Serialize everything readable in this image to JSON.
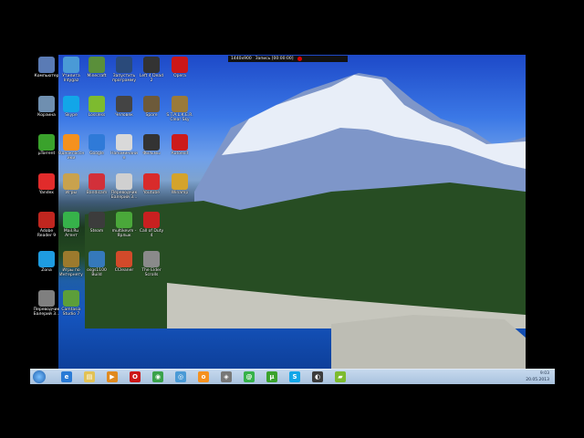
{
  "recording_bar": {
    "app": "1440x900",
    "status": "Запись [00:00:00]"
  },
  "desktop_icons": [
    {
      "label": "Компьютер",
      "icon": "computer-icon",
      "color": "#5a7bb5"
    },
    {
      "label": "Корзина",
      "icon": "recycle-bin-icon",
      "color": "#6f8fb0"
    },
    {
      "label": "μTorrent",
      "icon": "utorrent-icon",
      "color": "#3aa22c"
    },
    {
      "label": "Yandex",
      "icon": "yandex-icon",
      "color": "#e12b2b"
    },
    {
      "label": "Adobe Reader 9",
      "icon": "adobe-reader-icon",
      "color": "#c0261f"
    },
    {
      "label": "Zona",
      "icon": "zona-icon",
      "color": "#1e9ce0"
    },
    {
      "label": "Переводчик Балерий 3...",
      "icon": "translator-icon",
      "color": "#7f7f7f"
    },
    {
      "label": "Утилита Intygaz",
      "icon": "search-icon",
      "color": "#4a9ad6"
    },
    {
      "label": "Skype",
      "icon": "skype-icon",
      "color": "#12a6e8"
    },
    {
      "label": "Одноклассники",
      "icon": "odnoklassniki-icon",
      "color": "#f5911e"
    },
    {
      "label": "Игры",
      "icon": "games-icon",
      "color": "#c9a24d"
    },
    {
      "label": "Mail.Ru Агент",
      "icon": "mail-agent-icon",
      "color": "#36b24a"
    },
    {
      "label": "Игры по Интернету",
      "icon": "internet-games-icon",
      "color": "#9c7a2d"
    },
    {
      "label": "Camtasia Studio 7",
      "icon": "camtasia-icon",
      "color": "#5c9e3a"
    },
    {
      "label": "Minecraft",
      "icon": "minecraft-icon",
      "color": "#5a8f3a"
    },
    {
      "label": "Lossless",
      "icon": "lossless-icon",
      "color": "#7dbb2f"
    },
    {
      "label": "Google",
      "icon": "google-icon",
      "color": "#2f7ad8"
    },
    {
      "label": "Bandicam",
      "icon": "bandicam-icon",
      "color": "#d2303a"
    },
    {
      "label": "Steam",
      "icon": "steam-icon",
      "color": "#3c3c3c"
    },
    {
      "label": "osgs1100 Build",
      "icon": "globe-icon",
      "color": "#3579bb"
    },
    {
      "label": "Запустить программу",
      "icon": "run-program-icon",
      "color": "#2a4a7a"
    },
    {
      "label": "Человек",
      "icon": "person-icon",
      "color": "#444"
    },
    {
      "label": "Напоминание",
      "icon": "document-icon",
      "color": "#d9d9d9"
    },
    {
      "label": "Переводчик Балерий 3...",
      "icon": "translator-icon",
      "color": "#d0d0d0"
    },
    {
      "label": "multikevm - Ярлык",
      "icon": "tree-icon",
      "color": "#4aa83a"
    },
    {
      "label": "CCleaner",
      "icon": "ccleaner-icon",
      "color": "#d24a2a"
    },
    {
      "label": "Left 4 Dead 2",
      "icon": "left4dead-icon",
      "color": "#333"
    },
    {
      "label": "Spore",
      "icon": "spore-icon",
      "color": "#6d5a3a"
    },
    {
      "label": "Фильмы",
      "icon": "films-icon",
      "color": "#333"
    },
    {
      "label": "Youtube",
      "icon": "youtube-icon",
      "color": "#d92b2b"
    },
    {
      "label": "Call of Duty 4",
      "icon": "cod4-icon",
      "color": "#c82020"
    },
    {
      "label": "The Elder Scrolls",
      "icon": "skyrim-icon",
      "color": "#8a8a8a"
    },
    {
      "label": "Opera",
      "icon": "opera-icon",
      "color": "#cc1717"
    },
    {
      "label": "S.T.A.L.K.E.R. Clear Sky",
      "icon": "stalker-icon",
      "color": "#9a7a3a"
    },
    {
      "label": "Autoexit",
      "icon": "record-icon",
      "color": "#cc1b1b"
    },
    {
      "label": "Winamp",
      "icon": "winamp-icon",
      "color": "#d4a32c"
    }
  ],
  "taskbar": {
    "items": [
      {
        "icon": "ie-icon",
        "color": "#2a7bd6",
        "glyph": "e"
      },
      {
        "icon": "explorer-icon",
        "color": "#e2c255",
        "glyph": "▤"
      },
      {
        "icon": "media-player-icon",
        "color": "#e08a1f",
        "glyph": "▶"
      },
      {
        "icon": "opera-icon",
        "color": "#cc1717",
        "glyph": "O"
      },
      {
        "icon": "chrome-icon",
        "color": "#3aa24a",
        "glyph": "◉"
      },
      {
        "icon": "browser-icon",
        "color": "#4a9ad6",
        "glyph": "◎"
      },
      {
        "icon": "odnoklassniki-icon",
        "color": "#f5911e",
        "glyph": "о"
      },
      {
        "icon": "media-icon",
        "color": "#777",
        "glyph": "◈"
      },
      {
        "icon": "mail-agent-icon",
        "color": "#36b24a",
        "glyph": "@"
      },
      {
        "icon": "utorrent-icon",
        "color": "#3aa22c",
        "glyph": "µ"
      },
      {
        "icon": "skype-icon",
        "color": "#12a6e8",
        "glyph": "S"
      },
      {
        "icon": "steam-icon",
        "color": "#3c3c3c",
        "glyph": "◐"
      },
      {
        "icon": "lossless-icon",
        "color": "#7dbb2f",
        "glyph": "▰"
      }
    ],
    "tray_time": "9:03",
    "tray_date": "20.05.2013"
  }
}
